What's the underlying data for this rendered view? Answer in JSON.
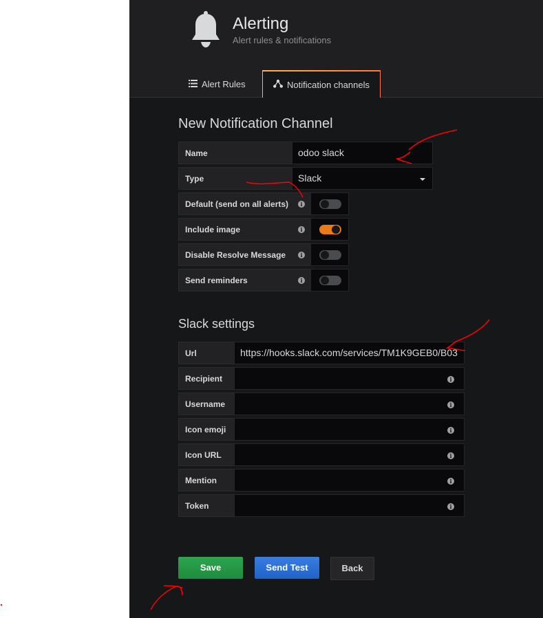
{
  "header": {
    "title": "Alerting",
    "subtitle": "Alert rules & notifications",
    "icon": "bell-icon"
  },
  "tabs": [
    {
      "label": "Alert Rules",
      "icon": "list-icon",
      "active": false
    },
    {
      "label": "Notification channels",
      "icon": "channels-icon",
      "active": true
    }
  ],
  "form": {
    "heading": "New Notification Channel",
    "name_label": "Name",
    "name_value": "odoo slack",
    "type_label": "Type",
    "type_value": "Slack",
    "toggles": [
      {
        "label": "Default (send on all alerts)",
        "on": false
      },
      {
        "label": "Include image",
        "on": true
      },
      {
        "label": "Disable Resolve Message",
        "on": false
      },
      {
        "label": "Send reminders",
        "on": false
      }
    ]
  },
  "slack": {
    "heading": "Slack settings",
    "fields": [
      {
        "label": "Url",
        "value": "https://hooks.slack.com/services/TM1K9GEB0/B03",
        "info": false
      },
      {
        "label": "Recipient",
        "value": "",
        "info": true
      },
      {
        "label": "Username",
        "value": "",
        "info": true
      },
      {
        "label": "Icon emoji",
        "value": "",
        "info": true
      },
      {
        "label": "Icon URL",
        "value": "",
        "info": true
      },
      {
        "label": "Mention",
        "value": "",
        "info": true
      },
      {
        "label": "Token",
        "value": "",
        "info": true
      }
    ]
  },
  "buttons": {
    "save": "Save",
    "send_test": "Send Test",
    "back": "Back"
  },
  "colors": {
    "accent": "#eb7b18",
    "save": "#299c46",
    "test": "#3274d9",
    "annotation": "#ff0000"
  }
}
